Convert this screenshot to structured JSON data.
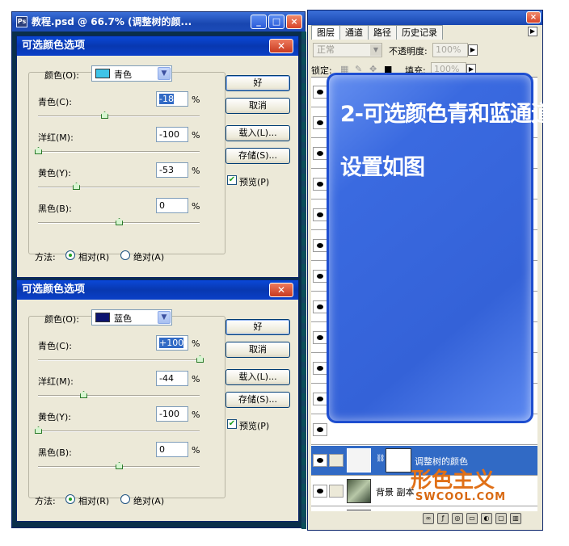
{
  "document_window": {
    "title": "教程.psd @ 66.7% (调整树的颜...",
    "buttons": [
      "_",
      "□",
      "×"
    ]
  },
  "dialogs": [
    {
      "title": "可选颜色选项",
      "colors_label": "颜色(O):",
      "selected_color": "青色",
      "swatch_color": "#3fc4e8",
      "sliders": [
        {
          "label": "青色(C):",
          "value": "-18",
          "pos": -18,
          "selected": true
        },
        {
          "label": "洋红(M):",
          "value": "-100",
          "pos": -100,
          "selected": false
        },
        {
          "label": "黄色(Y):",
          "value": "-53",
          "pos": -53,
          "selected": false
        },
        {
          "label": "黑色(B):",
          "value": "0",
          "pos": 0,
          "selected": false
        }
      ],
      "pct": "%",
      "buttons": {
        "ok": "好",
        "cancel": "取消",
        "load": "载入(L)...",
        "save": "存储(S)..."
      },
      "preview_label": "预览(P)",
      "method_label": "方法:",
      "relative_label": "相对(R)",
      "absolute_label": "绝对(A)"
    },
    {
      "title": "可选颜色选项",
      "colors_label": "颜色(O):",
      "selected_color": "蓝色",
      "swatch_color": "#0c1470",
      "sliders": [
        {
          "label": "青色(C):",
          "value": "+100",
          "pos": 100,
          "selected": true
        },
        {
          "label": "洋红(M):",
          "value": "-44",
          "pos": -44,
          "selected": false
        },
        {
          "label": "黄色(Y):",
          "value": "-100",
          "pos": -100,
          "selected": false
        },
        {
          "label": "黑色(B):",
          "value": "0",
          "pos": 0,
          "selected": false
        }
      ],
      "pct": "%",
      "buttons": {
        "ok": "好",
        "cancel": "取消",
        "load": "载入(L)...",
        "save": "存储(S)..."
      },
      "preview_label": "预览(P)",
      "method_label": "方法:",
      "relative_label": "相对(R)",
      "absolute_label": "绝对(A)"
    }
  ],
  "layers_panel": {
    "tabs": [
      "图层",
      "通道",
      "路径",
      "历史记录"
    ],
    "blend_mode": "正常",
    "opacity_label": "不透明度:",
    "opacity_value": "100%",
    "lock_label": "锁定:",
    "fill_label": "填充:",
    "fill_value": "100%",
    "layers": [
      {
        "name": "调整树的颜色",
        "selected": true
      },
      {
        "name": "背景 副本",
        "selected": false
      },
      {
        "name": "背景",
        "selected": false
      }
    ]
  },
  "callout": {
    "line1": "2-可选颜色青和蓝通道的",
    "line2": "设置如图"
  },
  "watermark": {
    "main": "形色主义",
    "sub": "SWCOOL.COM"
  }
}
